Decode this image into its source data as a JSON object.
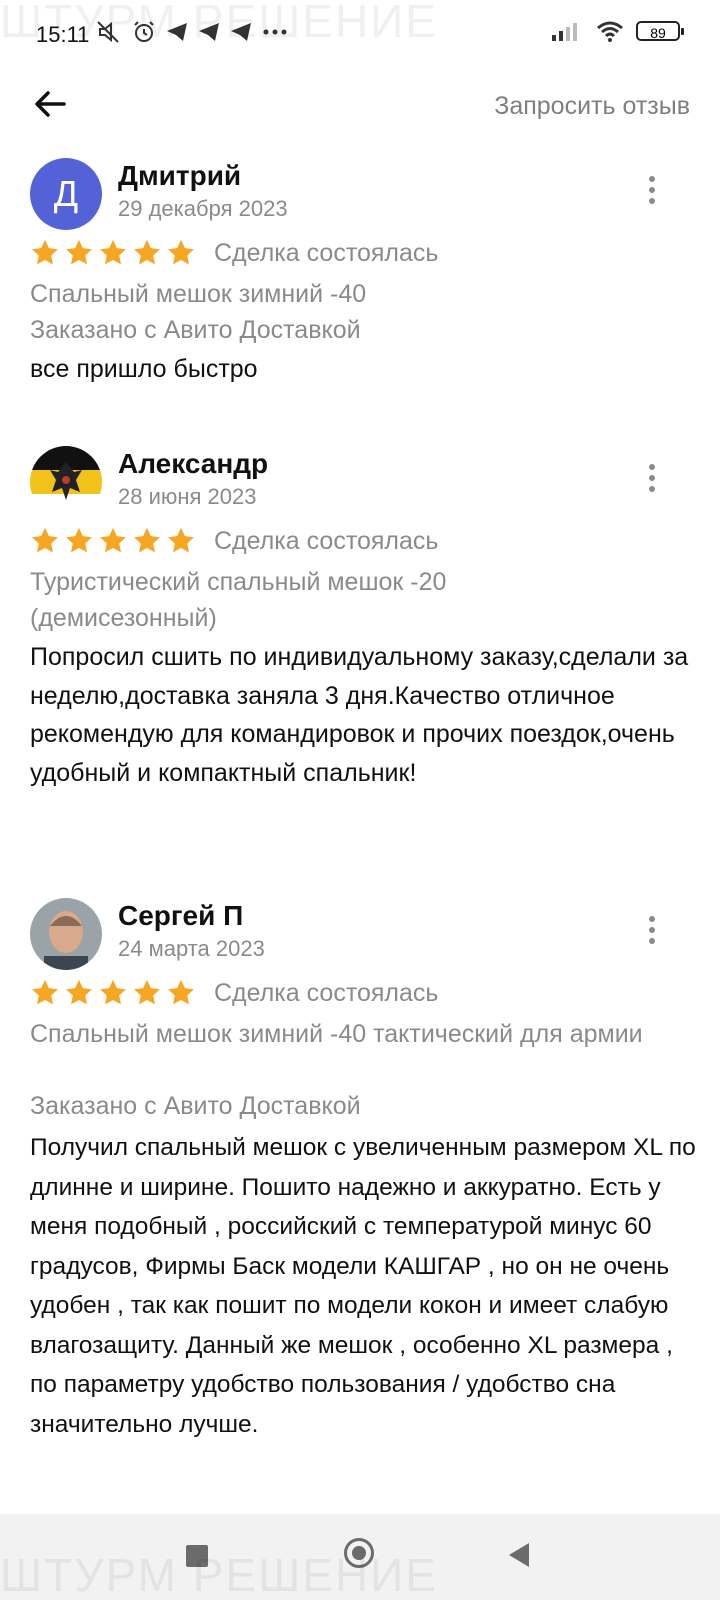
{
  "status_bar": {
    "time": "15:11",
    "battery": "89",
    "icons": [
      "mute-icon",
      "alarm-icon",
      "telegram-icon",
      "telegram-icon",
      "telegram-icon",
      "more-dots-icon",
      "signal-icon",
      "wifi-icon",
      "battery-icon"
    ]
  },
  "watermark": "ШТУРМ РЕШЕНИЕ",
  "header": {
    "back_icon": "arrow-left-icon",
    "request_review": "Запросить отзыв"
  },
  "colors": {
    "star": "#f5a623",
    "avatar_letter_bg": "#5462d8",
    "secondary_text": "#8a8a8a"
  },
  "reviews": [
    {
      "avatar_letter": "Д",
      "name": "Дмитрий",
      "date": "29 декабря 2023",
      "rating": 5,
      "deal_status": "Сделка состоялась",
      "product": "Спальный мешок зимний -40",
      "delivery": "Заказано с Авито Доставкой",
      "text": "все пришло быстро"
    },
    {
      "avatar_letter": "",
      "name": "Александр",
      "date": "28 июня 2023",
      "rating": 5,
      "deal_status": "Сделка состоялась",
      "product": "Туристический спальный мешок -20 (демисезонный)",
      "delivery": "",
      "text": "Попросил сшить по индивидуальному заказу,сделали за неделю,доставка заняла 3 дня.Качество отличное рекомендую для командировок и прочих поездок,очень удобный и компактный спальник!"
    },
    {
      "avatar_letter": "",
      "name": "Сергей П",
      "date": "24 марта 2023",
      "rating": 5,
      "deal_status": "Сделка состоялась",
      "product": "Спальный мешок зимний -40 тактический для армии",
      "delivery": "Заказано с Авито Доставкой",
      "text": "Получил  спальный мешок с увеличенным размером  XL  по длинне и ширине. Пошито надежно и аккуратно.  Есть у меня  подобный  , российский  с температурой  минус  60  градусов, Фирмы  Баск модели  КАШГАР , но он  не очень удобен , так как пошит  по модели кокон и имеет слабую влагозащиту.  Данный же мешок  , особенно  XL  размера  ,  по параметру удобство пользования / удобство сна значительно лучше."
    }
  ],
  "nav_bar": {
    "recents": "square-recents-icon",
    "home": "circle-home-icon",
    "back": "triangle-back-icon"
  }
}
